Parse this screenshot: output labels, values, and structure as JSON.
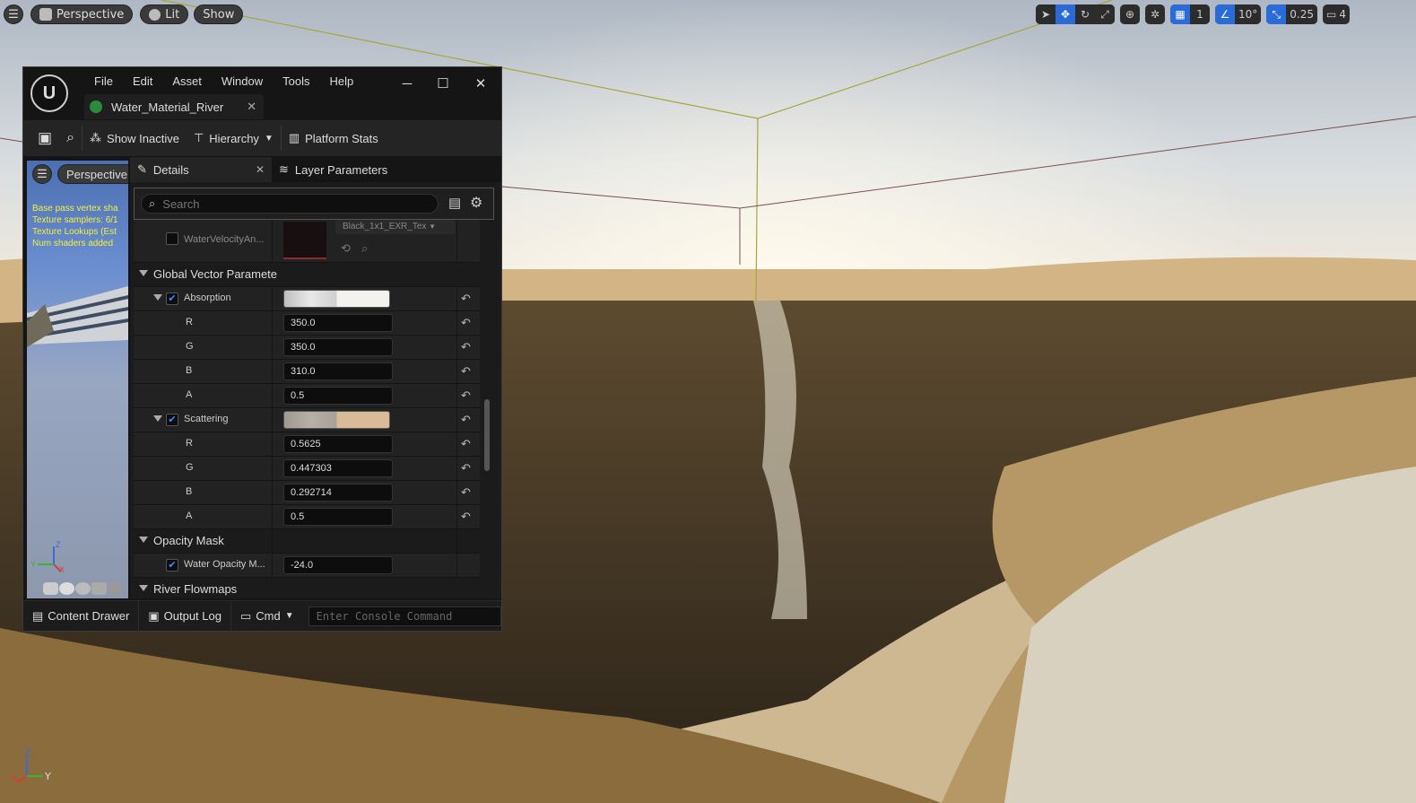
{
  "viewport": {
    "perspective_label": "Perspective",
    "lit_label": "Lit",
    "show_label": "Show",
    "grid_value": "1",
    "angle_value": "10°",
    "scale_value": "0.25",
    "camera_value": "4",
    "axis_z": "Z",
    "axis_y": "Y",
    "axis_x": "X"
  },
  "window": {
    "logo": "U",
    "menus": [
      "File",
      "Edit",
      "Asset",
      "Window",
      "Tools",
      "Help"
    ],
    "tab_title": "Water_Material_River",
    "toolbar": {
      "show_inactive": "Show Inactive",
      "hierarchy": "Hierarchy",
      "platform_stats": "Platform Stats"
    },
    "preview": {
      "perspective_label": "Perspective",
      "stats": [
        "Base pass vertex sha",
        "Texture samplers: 6/1",
        "Texture Lookups (Est",
        "Num shaders added"
      ],
      "axis_z": "Z",
      "axis_x": "X",
      "axis_y": "Y"
    },
    "details": {
      "tab_details": "Details",
      "tab_layer": "Layer Parameters",
      "search_placeholder": "Search",
      "texture_param": "WaterVelocityAn...",
      "texture_name": "Black_1x1_EXR_Tex",
      "cat_global_vector": "Global Vector Paramete",
      "absorption": "Absorption",
      "abs_r": "350.0",
      "abs_g": "350.0",
      "abs_b": "310.0",
      "abs_a": "0.5",
      "scattering": "Scattering",
      "sca_r": "0.5625",
      "sca_g": "0.447303",
      "sca_b": "0.292714",
      "sca_a": "0.5",
      "chan_r": "R",
      "chan_g": "G",
      "chan_b": "B",
      "chan_a": "A",
      "cat_opacity": "Opacity Mask",
      "opacity_param": "Water Opacity M...",
      "opacity_value": "-24.0",
      "cat_flowmaps": "River Flowmaps"
    },
    "bottom": {
      "content_drawer": "Content Drawer",
      "output_log": "Output Log",
      "cmd": "Cmd",
      "console_placeholder": "Enter Console Command"
    }
  },
  "colors": {
    "accent": "#2a6bd8",
    "scattering_swatch": "#d9bc97",
    "absorption_swatch": "#f4f2ee",
    "stats_text": "#f6f03a"
  }
}
